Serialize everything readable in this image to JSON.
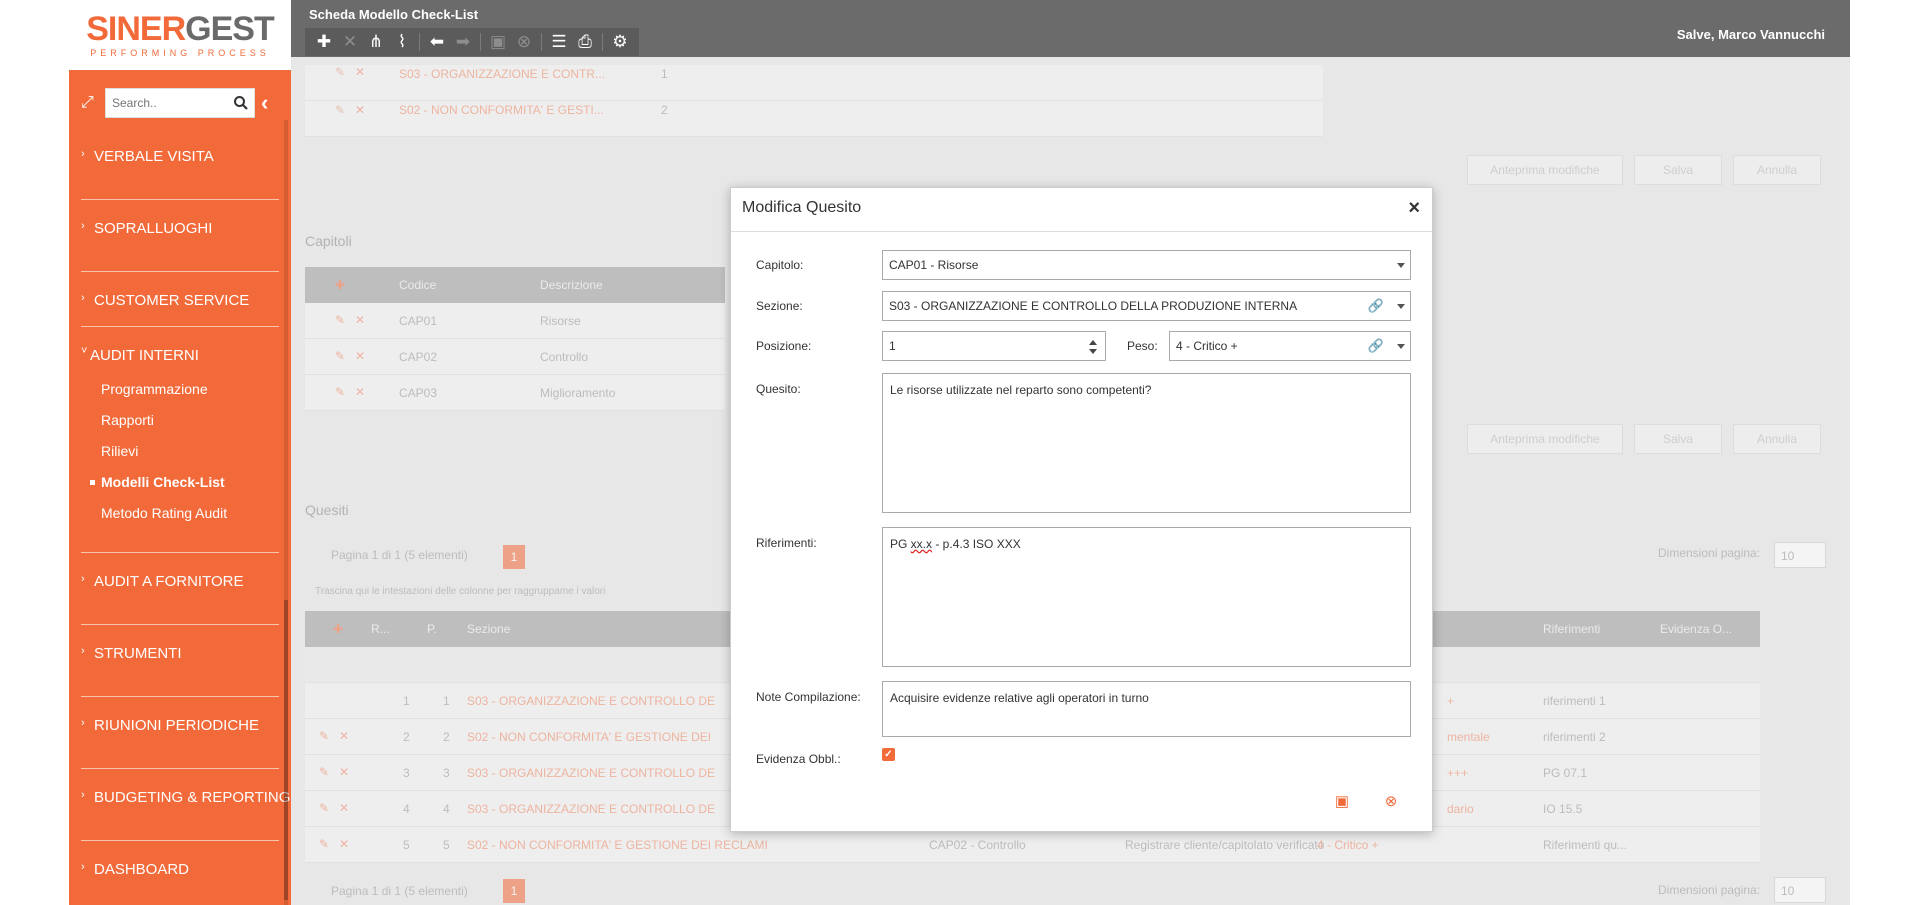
{
  "app": {
    "logo_text_part1": "SINER",
    "logo_text_part2": "GEST",
    "logo_tagline": "PERFORMING PROCESS",
    "page_title": "Scheda Modello Check-List",
    "user_greeting": "Salve, Marco Vannucchi"
  },
  "sidebar": {
    "search_placeholder": "Search..",
    "items": [
      {
        "label": "VERBALE VISITA"
      },
      {
        "label": "SOPRALLUOGHI"
      },
      {
        "label": "CUSTOMER SERVICE"
      },
      {
        "label": "AUDIT INTERNI"
      },
      {
        "label": "AUDIT A FORNITORE"
      },
      {
        "label": "STRUMENTI"
      },
      {
        "label": "RIUNIONI PERIODICHE"
      },
      {
        "label": "BUDGETING & REPORTING"
      },
      {
        "label": "DASHBOARD"
      }
    ],
    "sub_items": [
      {
        "label": "Programmazione"
      },
      {
        "label": "Rapporti"
      },
      {
        "label": "Rilievi"
      },
      {
        "label": "Modelli Check-List"
      },
      {
        "label": "Metodo Rating Audit"
      }
    ]
  },
  "background": {
    "sections_rows": [
      {
        "name": "S03 - ORGANIZZAZIONE E CONTR...",
        "num": "1"
      },
      {
        "name": "S02 - NON CONFORMITA' E GESTI...",
        "num": "2"
      }
    ],
    "btn_preview": "Anteprima modifiche",
    "btn_save": "Salva",
    "btn_cancel": "Annulla",
    "capitoli_title": "Capitoli",
    "capitoli_headers": {
      "codice": "Codice",
      "descrizione": "Descrizione"
    },
    "capitoli_rows": [
      {
        "codice": "CAP01",
        "descrizione": "Risorse"
      },
      {
        "codice": "CAP02",
        "descrizione": "Controllo"
      },
      {
        "codice": "CAP03",
        "descrizione": "Miglioramento"
      }
    ],
    "quesiti_title": "Quesiti",
    "pager_text": "Pagina 1 di 1 (5 elementi)",
    "pager_page": "1",
    "page_size_label": "Dimensioni pagina:",
    "page_size_value": "10",
    "group_hint": "Trascina qui le intestazioni delle colonne per raggruppame i valori",
    "grid_headers": {
      "r": "R...",
      "p": "P.",
      "sezione": "Sezione",
      "riferimenti": "Riferimenti",
      "evidenza": "Evidenza O..."
    },
    "grid_rows": [
      {
        "r": "1",
        "p": "1",
        "sezione": "S03 - ORGANIZZAZIONE E CONTROLLO DE",
        "peso": "+",
        "rif": "riferimenti 1",
        "ev": true
      },
      {
        "r": "2",
        "p": "2",
        "sezione": "S02 - NON CONFORMITA' E GESTIONE DEI",
        "peso": "mentale",
        "rif": "riferimenti 2",
        "ev": false
      },
      {
        "r": "3",
        "p": "3",
        "sezione": "S03 - ORGANIZZAZIONE E CONTROLLO DE",
        "peso": "+++",
        "rif": "PG 07.1",
        "ev": true
      },
      {
        "r": "4",
        "p": "4",
        "sezione": "S03 - ORGANIZZAZIONE E CONTROLLO DE",
        "peso": "dario",
        "rif": "IO 15.5",
        "ev": true
      },
      {
        "r": "5",
        "p": "5",
        "sezione": "S02 - NON CONFORMITA' E GESTIONE DEI RECLAMI",
        "capitolo": "CAP02 - Controllo",
        "quesito": "Registrare cliente/capitolato verificato",
        "peso": "4 - Critico +",
        "rif": "Riferimenti qu...",
        "ev": true
      }
    ]
  },
  "modal": {
    "title": "Modifica Quesito",
    "capitolo_label": "Capitolo:",
    "capitolo_value": "CAP01  - Risorse",
    "sezione_label": "Sezione:",
    "sezione_value": "S03  - ORGANIZZAZIONE E CONTROLLO DELLA PRODUZIONE INTERNA",
    "posizione_label": "Posizione:",
    "posizione_value": "1",
    "peso_label": "Peso:",
    "peso_value": "4  - Critico +",
    "quesito_label": "Quesito:",
    "quesito_value": "Le risorse utilizzate nel reparto sono competenti?",
    "riferimenti_label": "Riferimenti:",
    "riferimenti_prefix": "PG ",
    "riferimenti_marked": "xx.x",
    "riferimenti_suffix": " - p.4.3 ISO XXX",
    "note_label": "Note Compilazione:",
    "note_value": "Acquisire evidenze relative agli operatori in turno",
    "evidenza_label": "Evidenza Obbl.:",
    "evidenza_checked": true
  },
  "colors": {
    "accent": "#f26a3a",
    "header": "#6b6b6b"
  }
}
